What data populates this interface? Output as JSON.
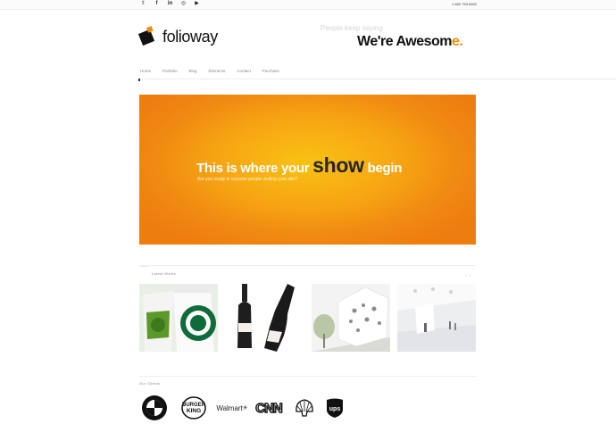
{
  "header": {
    "social_icons": [
      "twitter-icon",
      "facebook-icon",
      "linkedin-icon",
      "dribbble-icon",
      "youtube-icon"
    ],
    "phone": "1 800 753 8492"
  },
  "brand": {
    "name": "folioway"
  },
  "tagline": {
    "small": "People keep saying",
    "big_main": "We're Awesom",
    "big_accent": "e."
  },
  "nav": {
    "items": [
      "Home",
      "Portfolio",
      "Blog",
      "Elements",
      "Contact",
      "Purchase"
    ]
  },
  "hero": {
    "title_pre": "This is where your ",
    "title_show": "show",
    "title_post": " begin",
    "subtitle": "Are you ready to surprise people visiting your site?"
  },
  "works": {
    "heading": "Latest Works",
    "items": [
      "starbucks-cups",
      "abrau-bottles",
      "white-building",
      "white-interior"
    ]
  },
  "clients": {
    "heading": "Our Clients",
    "logos": [
      {
        "icon": "bmw-logo",
        "label": "BMW"
      },
      {
        "icon": "burger-king-logo",
        "label": "BURGER KING"
      },
      {
        "icon": "walmart-logo",
        "label": "Walmart"
      },
      {
        "icon": "cnn-logo",
        "label": "CNN"
      },
      {
        "icon": "shell-logo",
        "label": ""
      },
      {
        "icon": "ups-logo",
        "label": "ups"
      }
    ]
  },
  "colors": {
    "accent": "#f28c0f",
    "hero_center": "#f9c213",
    "hero_edge": "#ee7d10"
  }
}
